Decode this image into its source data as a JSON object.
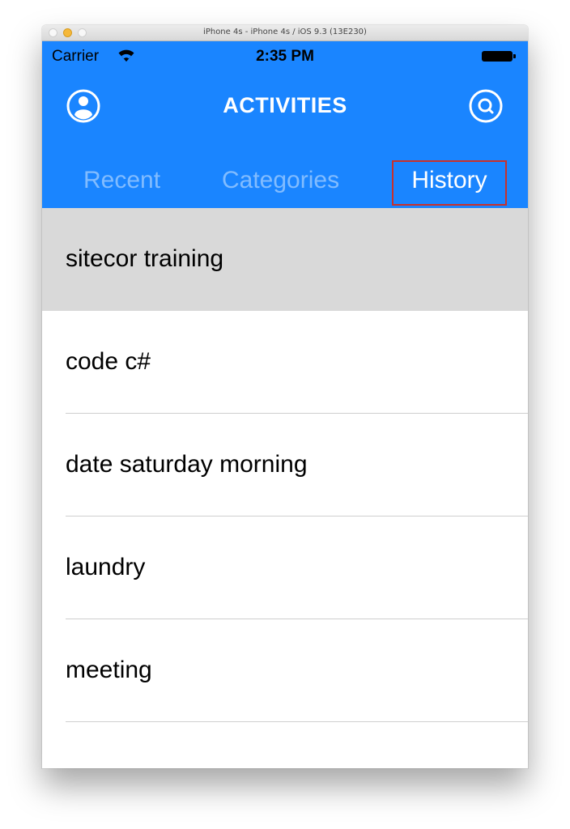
{
  "window": {
    "title": "iPhone 4s - iPhone 4s / iOS 9.3 (13E230)"
  },
  "status_bar": {
    "carrier": "Carrier",
    "time": "2:35 PM"
  },
  "navbar": {
    "title": "ACTIVITIES",
    "left_icon": "profile-icon",
    "right_icon": "search-icon"
  },
  "tabs": [
    {
      "label": "Recent",
      "active": false
    },
    {
      "label": "Categories",
      "active": false
    },
    {
      "label": "History",
      "active": true
    }
  ],
  "list": {
    "items": [
      {
        "label": "sitecor training",
        "selected": true
      },
      {
        "label": "code c#",
        "selected": false
      },
      {
        "label": "date saturday morning",
        "selected": false
      },
      {
        "label": "laundry",
        "selected": false
      },
      {
        "label": "meeting",
        "selected": false
      },
      {
        "label": "",
        "selected": false
      }
    ]
  },
  "colors": {
    "header": "#1a85ff",
    "selected_row": "#d9d9d9",
    "tab_highlight_border": "#c8312b"
  }
}
